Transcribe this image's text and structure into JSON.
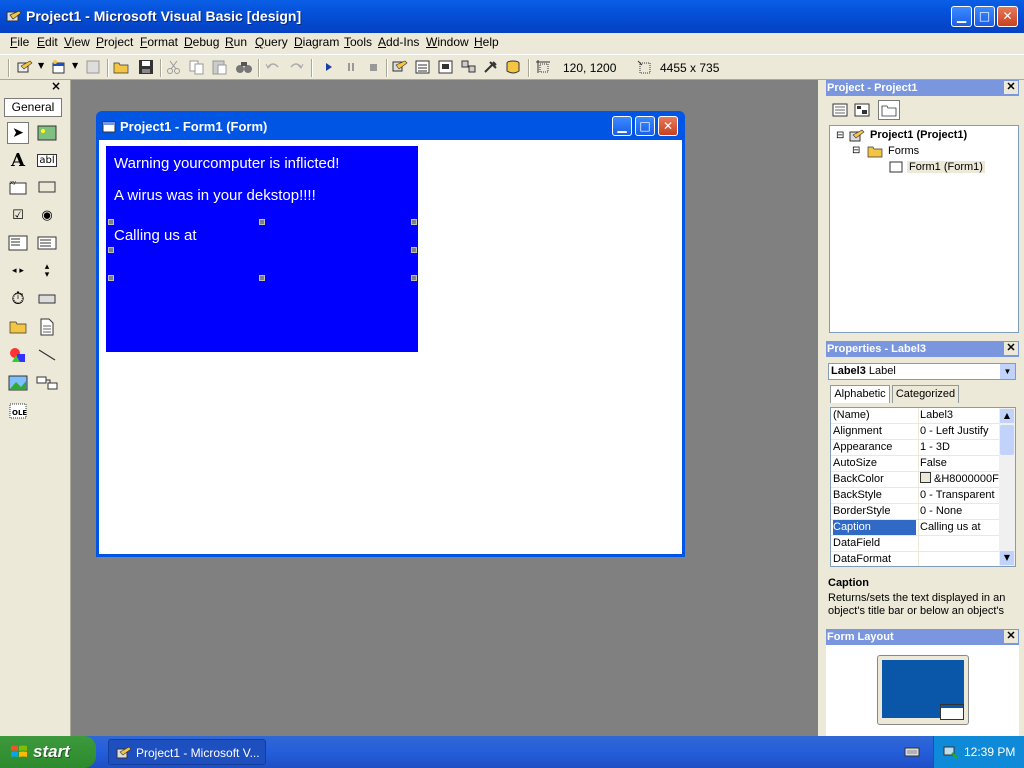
{
  "window": {
    "title": "Project1 - Microsoft Visual Basic [design]"
  },
  "menu": [
    "File",
    "Edit",
    "View",
    "Project",
    "Format",
    "Debug",
    "Run",
    "Query",
    "Diagram",
    "Tools",
    "Add-Ins",
    "Window",
    "Help"
  ],
  "toolbar": {
    "position": "120, 1200",
    "size": "4455 x 735"
  },
  "toolbox": {
    "tab_label": "General",
    "close": "×"
  },
  "form": {
    "title": "Project1 - Form1 (Form)",
    "labels": [
      "Warning yourcomputer is inflicted!",
      "A wirus was in your dekstop!!!!",
      "Calling us at"
    ],
    "panel_color": "#0000ff"
  },
  "project_explorer": {
    "title": "Project - Project1",
    "tree": [
      "Project1 (Project1)",
      "Forms",
      "Form1 (Form1)"
    ]
  },
  "properties": {
    "title": "Properties - Label3",
    "object_name": "Label3",
    "object_type": "Label",
    "tabs": [
      "Alphabetic",
      "Categorized"
    ],
    "rows": [
      {
        "name": "(Name)",
        "value": "Label3"
      },
      {
        "name": "Alignment",
        "value": "0 - Left Justify"
      },
      {
        "name": "Appearance",
        "value": "1 - 3D"
      },
      {
        "name": "AutoSize",
        "value": "False"
      },
      {
        "name": "BackColor",
        "value": "&H8000000F"
      },
      {
        "name": "BackStyle",
        "value": "0 - Transparent"
      },
      {
        "name": "BorderStyle",
        "value": "0 - None"
      },
      {
        "name": "Caption",
        "value": "Calling us at"
      },
      {
        "name": "DataField",
        "value": ""
      },
      {
        "name": "DataFormat",
        "value": ""
      }
    ],
    "selected_row": "Caption",
    "description_title": "Caption",
    "description_text": "Returns/sets the text displayed in an object's title bar or below an object's"
  },
  "form_layout": {
    "title": "Form Layout"
  },
  "taskbar": {
    "start_label": "start",
    "task_label": "Project1 - Microsoft V...",
    "clock": "12:39 PM"
  }
}
